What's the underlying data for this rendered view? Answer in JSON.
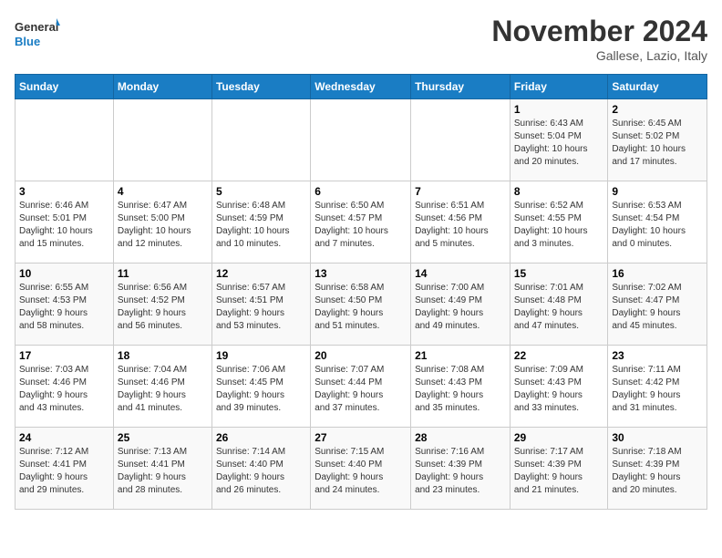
{
  "logo": {
    "line1": "General",
    "line2": "Blue"
  },
  "title": "November 2024",
  "subtitle": "Gallese, Lazio, Italy",
  "weekdays": [
    "Sunday",
    "Monday",
    "Tuesday",
    "Wednesday",
    "Thursday",
    "Friday",
    "Saturday"
  ],
  "weeks": [
    [
      {
        "day": "",
        "info": ""
      },
      {
        "day": "",
        "info": ""
      },
      {
        "day": "",
        "info": ""
      },
      {
        "day": "",
        "info": ""
      },
      {
        "day": "",
        "info": ""
      },
      {
        "day": "1",
        "info": "Sunrise: 6:43 AM\nSunset: 5:04 PM\nDaylight: 10 hours\nand 20 minutes."
      },
      {
        "day": "2",
        "info": "Sunrise: 6:45 AM\nSunset: 5:02 PM\nDaylight: 10 hours\nand 17 minutes."
      }
    ],
    [
      {
        "day": "3",
        "info": "Sunrise: 6:46 AM\nSunset: 5:01 PM\nDaylight: 10 hours\nand 15 minutes."
      },
      {
        "day": "4",
        "info": "Sunrise: 6:47 AM\nSunset: 5:00 PM\nDaylight: 10 hours\nand 12 minutes."
      },
      {
        "day": "5",
        "info": "Sunrise: 6:48 AM\nSunset: 4:59 PM\nDaylight: 10 hours\nand 10 minutes."
      },
      {
        "day": "6",
        "info": "Sunrise: 6:50 AM\nSunset: 4:57 PM\nDaylight: 10 hours\nand 7 minutes."
      },
      {
        "day": "7",
        "info": "Sunrise: 6:51 AM\nSunset: 4:56 PM\nDaylight: 10 hours\nand 5 minutes."
      },
      {
        "day": "8",
        "info": "Sunrise: 6:52 AM\nSunset: 4:55 PM\nDaylight: 10 hours\nand 3 minutes."
      },
      {
        "day": "9",
        "info": "Sunrise: 6:53 AM\nSunset: 4:54 PM\nDaylight: 10 hours\nand 0 minutes."
      }
    ],
    [
      {
        "day": "10",
        "info": "Sunrise: 6:55 AM\nSunset: 4:53 PM\nDaylight: 9 hours\nand 58 minutes."
      },
      {
        "day": "11",
        "info": "Sunrise: 6:56 AM\nSunset: 4:52 PM\nDaylight: 9 hours\nand 56 minutes."
      },
      {
        "day": "12",
        "info": "Sunrise: 6:57 AM\nSunset: 4:51 PM\nDaylight: 9 hours\nand 53 minutes."
      },
      {
        "day": "13",
        "info": "Sunrise: 6:58 AM\nSunset: 4:50 PM\nDaylight: 9 hours\nand 51 minutes."
      },
      {
        "day": "14",
        "info": "Sunrise: 7:00 AM\nSunset: 4:49 PM\nDaylight: 9 hours\nand 49 minutes."
      },
      {
        "day": "15",
        "info": "Sunrise: 7:01 AM\nSunset: 4:48 PM\nDaylight: 9 hours\nand 47 minutes."
      },
      {
        "day": "16",
        "info": "Sunrise: 7:02 AM\nSunset: 4:47 PM\nDaylight: 9 hours\nand 45 minutes."
      }
    ],
    [
      {
        "day": "17",
        "info": "Sunrise: 7:03 AM\nSunset: 4:46 PM\nDaylight: 9 hours\nand 43 minutes."
      },
      {
        "day": "18",
        "info": "Sunrise: 7:04 AM\nSunset: 4:46 PM\nDaylight: 9 hours\nand 41 minutes."
      },
      {
        "day": "19",
        "info": "Sunrise: 7:06 AM\nSunset: 4:45 PM\nDaylight: 9 hours\nand 39 minutes."
      },
      {
        "day": "20",
        "info": "Sunrise: 7:07 AM\nSunset: 4:44 PM\nDaylight: 9 hours\nand 37 minutes."
      },
      {
        "day": "21",
        "info": "Sunrise: 7:08 AM\nSunset: 4:43 PM\nDaylight: 9 hours\nand 35 minutes."
      },
      {
        "day": "22",
        "info": "Sunrise: 7:09 AM\nSunset: 4:43 PM\nDaylight: 9 hours\nand 33 minutes."
      },
      {
        "day": "23",
        "info": "Sunrise: 7:11 AM\nSunset: 4:42 PM\nDaylight: 9 hours\nand 31 minutes."
      }
    ],
    [
      {
        "day": "24",
        "info": "Sunrise: 7:12 AM\nSunset: 4:41 PM\nDaylight: 9 hours\nand 29 minutes."
      },
      {
        "day": "25",
        "info": "Sunrise: 7:13 AM\nSunset: 4:41 PM\nDaylight: 9 hours\nand 28 minutes."
      },
      {
        "day": "26",
        "info": "Sunrise: 7:14 AM\nSunset: 4:40 PM\nDaylight: 9 hours\nand 26 minutes."
      },
      {
        "day": "27",
        "info": "Sunrise: 7:15 AM\nSunset: 4:40 PM\nDaylight: 9 hours\nand 24 minutes."
      },
      {
        "day": "28",
        "info": "Sunrise: 7:16 AM\nSunset: 4:39 PM\nDaylight: 9 hours\nand 23 minutes."
      },
      {
        "day": "29",
        "info": "Sunrise: 7:17 AM\nSunset: 4:39 PM\nDaylight: 9 hours\nand 21 minutes."
      },
      {
        "day": "30",
        "info": "Sunrise: 7:18 AM\nSunset: 4:39 PM\nDaylight: 9 hours\nand 20 minutes."
      }
    ]
  ]
}
